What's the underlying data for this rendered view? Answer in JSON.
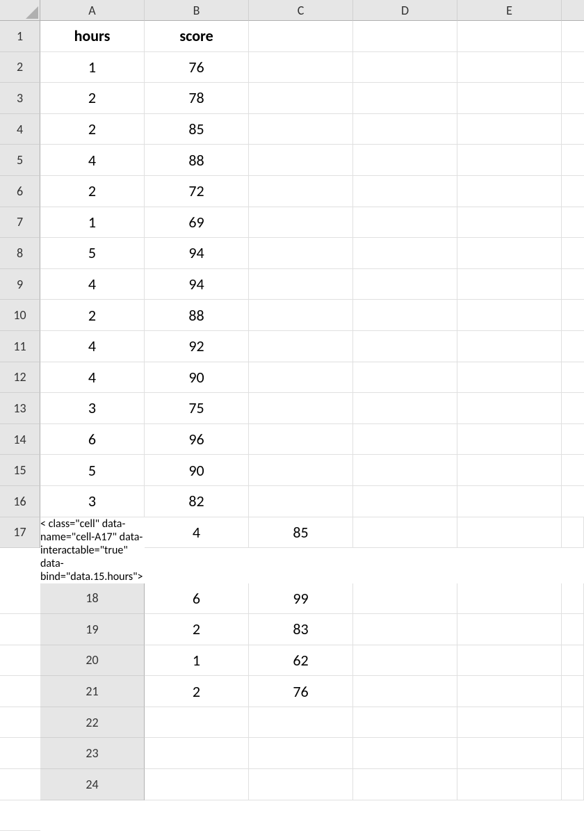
{
  "columns": [
    "A",
    "B",
    "C",
    "D",
    "E"
  ],
  "rows": [
    1,
    2,
    3,
    4,
    5,
    6,
    7,
    8,
    9,
    10,
    11,
    12,
    13,
    14,
    15,
    16,
    17,
    18,
    19,
    20,
    21,
    22,
    23,
    24
  ],
  "headers": {
    "A": "hours",
    "B": "score"
  },
  "data": [
    {
      "hours": "1",
      "score": "76"
    },
    {
      "hours": "2",
      "score": "78"
    },
    {
      "hours": "2",
      "score": "85"
    },
    {
      "hours": "4",
      "score": "88"
    },
    {
      "hours": "2",
      "score": "72"
    },
    {
      "hours": "1",
      "score": "69"
    },
    {
      "hours": "5",
      "score": "94"
    },
    {
      "hours": "4",
      "score": "94"
    },
    {
      "hours": "2",
      "score": "88"
    },
    {
      "hours": "4",
      "score": "92"
    },
    {
      "hours": "4",
      "score": "90"
    },
    {
      "hours": "3",
      "score": "75"
    },
    {
      "hours": "6",
      "score": "96"
    },
    {
      "hours": "5",
      "score": "90"
    },
    {
      "hours": "3",
      "score": "82"
    },
    {
      "hours": "4",
      "score": "85"
    },
    {
      "hours": "6",
      "score": "99"
    },
    {
      "hours": "2",
      "score": "83"
    },
    {
      "hours": "1",
      "score": "62"
    },
    {
      "hours": "2",
      "score": "76"
    }
  ],
  "chart_data": {
    "type": "table",
    "title": "",
    "columns": [
      "hours",
      "score"
    ],
    "rows": [
      [
        1,
        76
      ],
      [
        2,
        78
      ],
      [
        2,
        85
      ],
      [
        4,
        88
      ],
      [
        2,
        72
      ],
      [
        1,
        69
      ],
      [
        5,
        94
      ],
      [
        4,
        94
      ],
      [
        2,
        88
      ],
      [
        4,
        92
      ],
      [
        4,
        90
      ],
      [
        3,
        75
      ],
      [
        6,
        96
      ],
      [
        5,
        90
      ],
      [
        3,
        82
      ],
      [
        4,
        85
      ],
      [
        6,
        99
      ],
      [
        2,
        83
      ],
      [
        1,
        62
      ],
      [
        2,
        76
      ]
    ]
  }
}
